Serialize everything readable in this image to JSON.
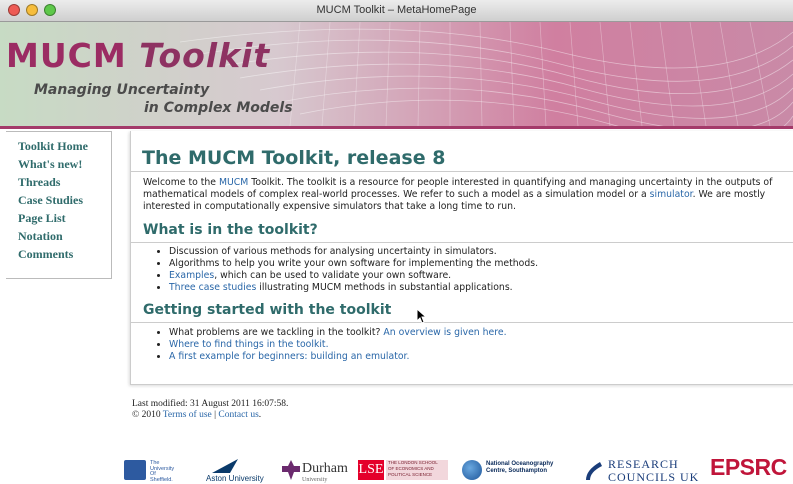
{
  "window": {
    "title": "MUCM Toolkit – MetaHomePage"
  },
  "banner": {
    "logo_prefix": "MUCM ",
    "logo_suffix": "Toolkit",
    "tagline_1": "Managing Uncertainty",
    "tagline_2": "in Complex Models"
  },
  "sidebar": {
    "items": [
      {
        "label": "Toolkit Home"
      },
      {
        "label": "What's new!"
      },
      {
        "label": "Threads"
      },
      {
        "label": "Case Studies"
      },
      {
        "label": "Page List"
      },
      {
        "label": "Notation"
      },
      {
        "label": "Comments"
      }
    ]
  },
  "main": {
    "title": "The MUCM Toolkit, release 8",
    "intro": {
      "p1": "Welcome to the ",
      "mucm_link": "MUCM",
      "p2": " Toolkit. The toolkit is a resource for people interested in quantifying and managing uncertainty in the outputs of mathematical models of complex real-world processes. We refer to such a model as a simulation model or a ",
      "simulator_link": "simulator",
      "p3": ". We are mostly interested in computationally expensive simulators that take a long time to run."
    },
    "section1": {
      "heading": "What is in the toolkit?",
      "item1": "Discussion of various methods for analysing uncertainty in simulators.",
      "item2": "Algorithms to help you write your own software for implementing the methods.",
      "item3_link": "Examples",
      "item3_text": ", which can be used to validate your own software.",
      "item4_link": "Three case studies",
      "item4_text": " illustrating MUCM methods in substantial applications."
    },
    "section2": {
      "heading": "Getting started with the toolkit",
      "item1_text": "What problems are we tackling in the toolkit? ",
      "item1_link": "An overview is given here.",
      "item2_link": "Where to find things in the toolkit.",
      "item3_link": "A first example for beginners: building an emulator."
    }
  },
  "footer": {
    "last_modified": "Last modified: 31 August 2011 16:07:58.",
    "copyright": "© 2010 ",
    "terms_link": "Terms of use",
    "separator": " | ",
    "contact_link": "Contact us",
    "period": "."
  },
  "partners": {
    "sheffield_1": "The",
    "sheffield_2": "University",
    "sheffield_3": "Of",
    "sheffield_4": "Sheffield.",
    "aston": "Aston University",
    "durham": "Durham",
    "durham_sub": "University",
    "lse_mark": "LSE",
    "lse_1": "THE LONDON SCHOOL",
    "lse_2": "OF ECONOMICS AND",
    "lse_3": "POLITICAL SCIENCE",
    "noc_1": "National Oceanography",
    "noc_2": "Centre, Southampton",
    "rcuk_1": "RESEARCH",
    "rcuk_2": "COUNCILS UK",
    "epsrc": "EPSRC"
  }
}
